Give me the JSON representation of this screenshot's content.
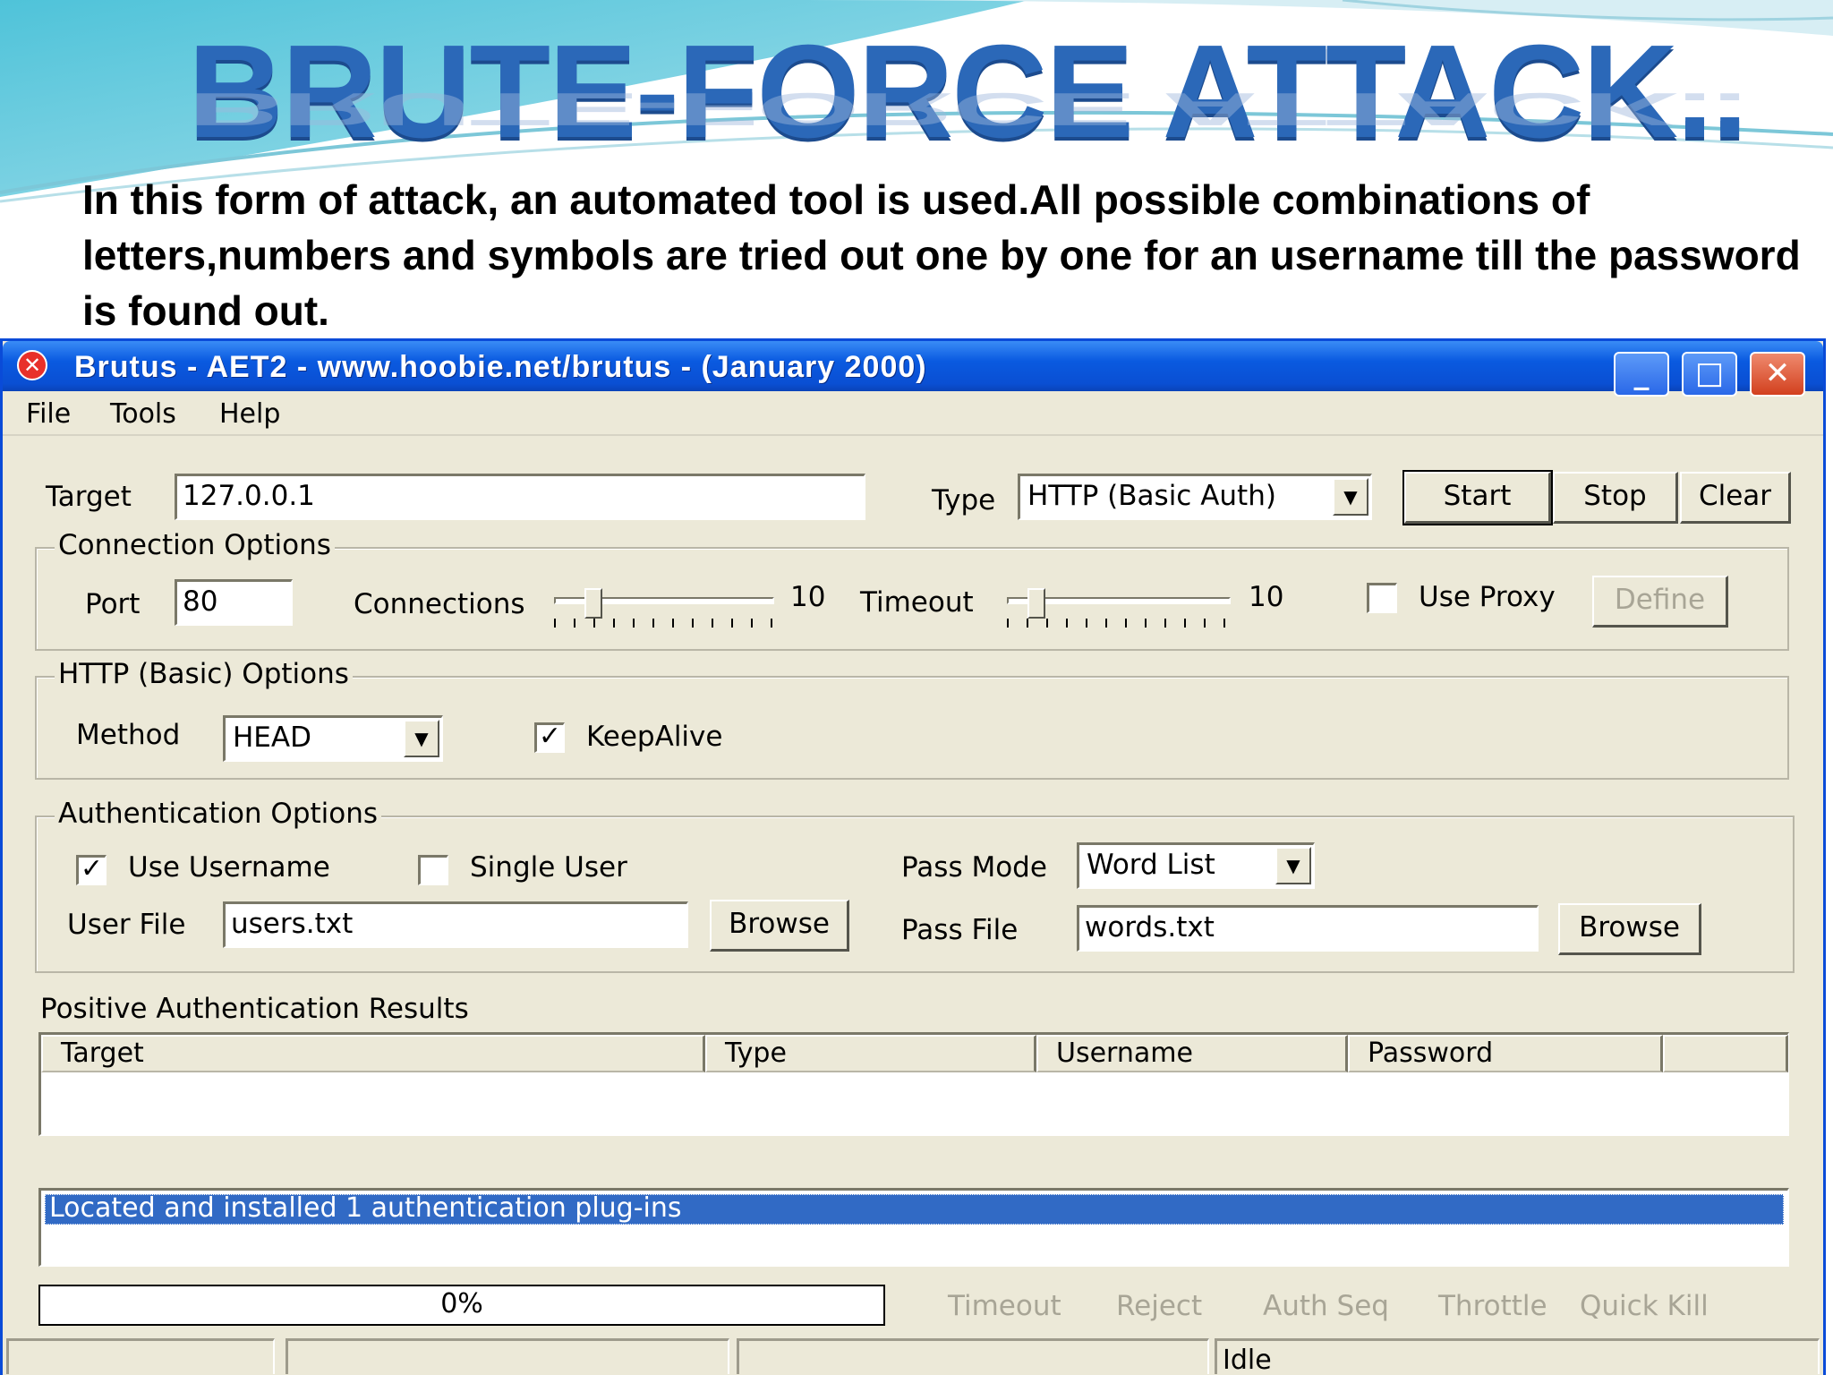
{
  "slide": {
    "title": "BRUTE-FORCE ATTACK..",
    "text": "In this form of attack, an automated tool is used.All possible combinations of letters,numbers and symbols are tried out one by one for an username till the password is found out."
  },
  "window": {
    "icon": "✕",
    "title": "Brutus  - AET2  - www.hoobie.net/brutus  - (January 2000)",
    "controls": {
      "minimize": "_",
      "maximize": "□",
      "close": "✕"
    },
    "menu": [
      "File",
      "Tools",
      "Help"
    ]
  },
  "target_row": {
    "target_label": "Target",
    "target_value": "127.0.0.1",
    "type_label": "Type",
    "type_value": "HTTP (Basic Auth)",
    "start": "Start",
    "stop": "Stop",
    "clear": "Clear"
  },
  "connection": {
    "group_label": "Connection Options",
    "port_label": "Port",
    "port_value": "80",
    "connections_label": "Connections",
    "connections_value": "10",
    "connections_level": 0.15,
    "timeout_label": "Timeout",
    "timeout_value": "10",
    "timeout_level": 0.1,
    "use_proxy_label": "Use Proxy",
    "use_proxy_checked": false,
    "define": "Define"
  },
  "http": {
    "group_label": "HTTP (Basic) Options",
    "method_label": "Method",
    "method_value": "HEAD",
    "keepalive_label": "KeepAlive",
    "keepalive_checked": true,
    "check_mark": "✓"
  },
  "auth": {
    "group_label": "Authentication Options",
    "use_username_label": "Use Username",
    "use_username_checked": true,
    "single_user_label": "Single User",
    "single_user_checked": false,
    "pass_mode_label": "Pass Mode",
    "pass_mode_value": "Word List",
    "user_file_label": "User File",
    "user_file_value": "users.txt",
    "browse": "Browse",
    "pass_file_label": "Pass File",
    "pass_file_value": "words.txt"
  },
  "results": {
    "label": "Positive Authentication Results",
    "columns": [
      "Target",
      "Type",
      "Username",
      "Password"
    ]
  },
  "log": {
    "line": "Located and installed 1 authentication plug-ins"
  },
  "bottom": {
    "progress_text": "0%",
    "timeout": "Timeout",
    "reject": "Reject",
    "auth_seq": "Auth Seq",
    "throttle": "Throttle",
    "quick_kill": "Quick Kill",
    "status": "Idle"
  }
}
